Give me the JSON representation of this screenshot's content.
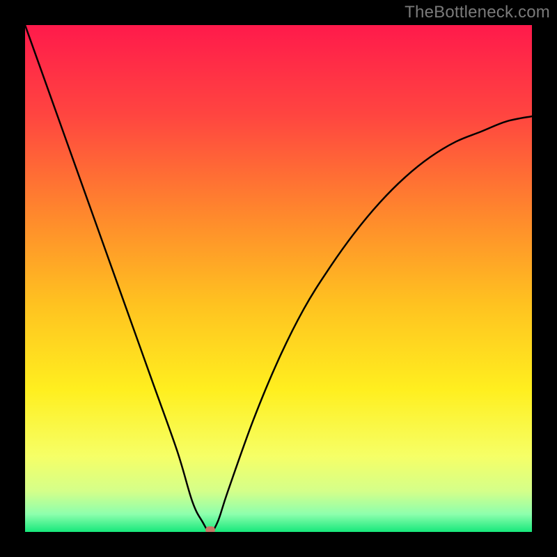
{
  "watermark": "TheBottleneck.com",
  "chart_data": {
    "type": "line",
    "title": "",
    "xlabel": "",
    "ylabel": "",
    "xlim": [
      0,
      100
    ],
    "ylim": [
      0,
      100
    ],
    "series": [
      {
        "name": "bottleneck-curve",
        "x": [
          0,
          5,
          10,
          15,
          20,
          25,
          30,
          33,
          35,
          36.5,
          38,
          40,
          45,
          50,
          55,
          60,
          65,
          70,
          75,
          80,
          85,
          90,
          95,
          100
        ],
        "values": [
          100,
          86,
          72,
          58,
          44,
          30,
          16,
          6,
          2,
          0,
          2,
          8,
          22,
          34,
          44,
          52,
          59,
          65,
          70,
          74,
          77,
          79,
          81,
          82
        ]
      }
    ],
    "min_point": {
      "x": 36.5,
      "y": 0
    },
    "gradient_stops": [
      {
        "offset": 0,
        "color": "#ff1a4b"
      },
      {
        "offset": 0.18,
        "color": "#ff4640"
      },
      {
        "offset": 0.38,
        "color": "#ff8a2c"
      },
      {
        "offset": 0.55,
        "color": "#ffc220"
      },
      {
        "offset": 0.72,
        "color": "#ffef1f"
      },
      {
        "offset": 0.85,
        "color": "#f6ff66"
      },
      {
        "offset": 0.92,
        "color": "#d4ff8a"
      },
      {
        "offset": 0.965,
        "color": "#8dffad"
      },
      {
        "offset": 1.0,
        "color": "#17e87b"
      }
    ],
    "marker_color": "#c67766",
    "curve_stroke": "#000000"
  }
}
